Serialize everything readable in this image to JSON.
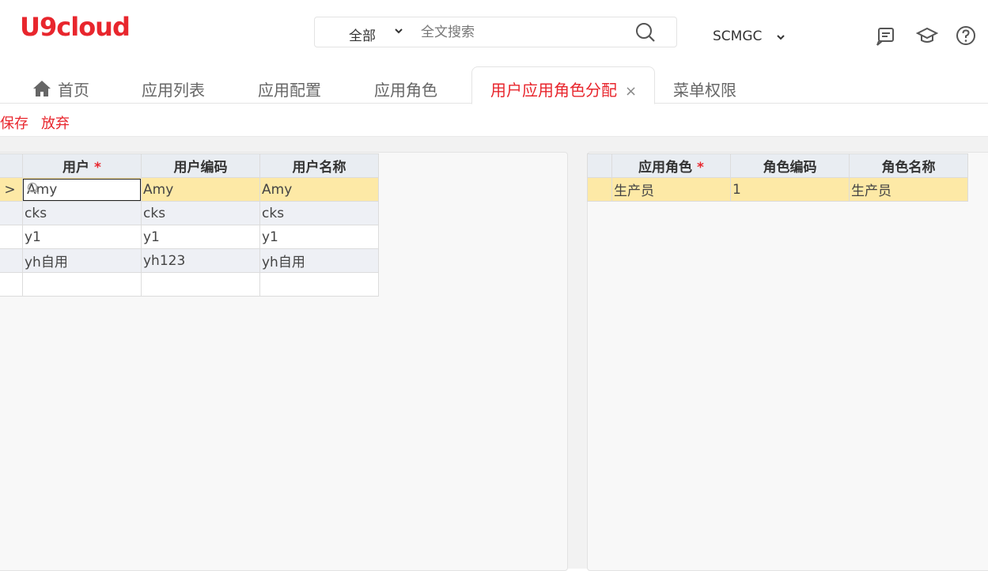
{
  "header": {
    "logo_text": "U9cloud",
    "search": {
      "scope": "全部",
      "placeholder": "全文搜索"
    },
    "org": "SCMGC",
    "icons": [
      "message-icon",
      "graduation-cap-icon",
      "help-icon"
    ]
  },
  "tabs": [
    {
      "label": "首页"
    },
    {
      "label": "应用列表"
    },
    {
      "label": "应用配置"
    },
    {
      "label": "应用角色"
    },
    {
      "label": "用户应用角色分配",
      "active": true,
      "close": "×"
    },
    {
      "label": "菜单权限"
    }
  ],
  "toolbar": {
    "save": "保存",
    "discard": "放弃"
  },
  "user_grid": {
    "columns": [
      "用户",
      "用户编码",
      "用户名称"
    ],
    "required_mark": "*",
    "current_marker": ">",
    "rows": [
      [
        "Amy",
        "Amy",
        "Amy"
      ],
      [
        "cks",
        "cks",
        "cks"
      ],
      [
        "y1",
        "y1",
        "y1"
      ],
      [
        "yh自用",
        "yh123",
        "yh自用"
      ],
      [
        "",
        "",
        ""
      ]
    ]
  },
  "role_grid": {
    "columns": [
      "应用角色",
      "角色编码",
      "角色名称"
    ],
    "required_mark": "*",
    "rows": [
      [
        "生产员",
        "1",
        "生产员"
      ]
    ]
  },
  "colors": {
    "brand": "#e8262d",
    "selected_row": "#fde9a6",
    "header_bg": "#e9edf2"
  }
}
